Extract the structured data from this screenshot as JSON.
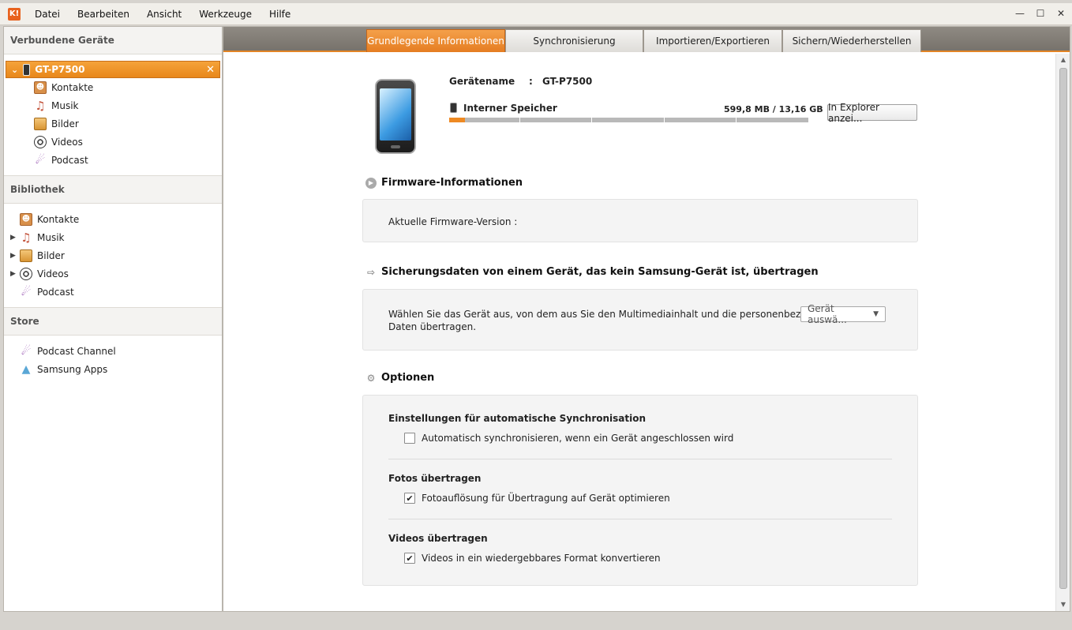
{
  "menu": {
    "logo": "K!",
    "items": [
      "Datei",
      "Bearbeiten",
      "Ansicht",
      "Werkzeuge",
      "Hilfe"
    ],
    "win_controls": [
      "—",
      "☐",
      "✕"
    ]
  },
  "sidebar": {
    "connected_header": "Verbundene Geräte",
    "device": {
      "name": "GT-P7500",
      "close": "✕",
      "expand": "⌄"
    },
    "device_items": [
      {
        "label": "Kontakte",
        "icon": "contacts-icon"
      },
      {
        "label": "Musik",
        "icon": "music-icon"
      },
      {
        "label": "Bilder",
        "icon": "pictures-icon"
      },
      {
        "label": "Videos",
        "icon": "videos-icon"
      },
      {
        "label": "Podcast",
        "icon": "podcast-icon"
      }
    ],
    "library_header": "Bibliothek",
    "library_items": [
      {
        "label": "Kontakte",
        "expandable": false
      },
      {
        "label": "Musik",
        "expandable": true
      },
      {
        "label": "Bilder",
        "expandable": true
      },
      {
        "label": "Videos",
        "expandable": true
      },
      {
        "label": "Podcast",
        "expandable": false
      }
    ],
    "store_header": "Store",
    "store_items": [
      {
        "label": "Podcast Channel",
        "icon": "podcast-channel-icon"
      },
      {
        "label": "Samsung Apps",
        "icon": "samsung-apps-icon"
      }
    ]
  },
  "tabs": [
    {
      "label": "Grundlegende Informationen",
      "active": true
    },
    {
      "label": "Synchronisierung",
      "active": false
    },
    {
      "label": "Importieren/Exportieren",
      "active": false
    },
    {
      "label": "Sichern/Wiederherstellen",
      "active": false
    }
  ],
  "device_info": {
    "name_label": "Gerätename",
    "separator": ":",
    "name_value": "GT-P7500",
    "storage_label": "Interner Speicher",
    "storage_value": "599,8 MB / 13,16 GB",
    "storage_used_fraction": 0.0445,
    "explorer_button": "In Explorer anzei..."
  },
  "firmware": {
    "title": "Firmware-Informationen",
    "current_label": "Aktuelle Firmware-Version :"
  },
  "transfer": {
    "title": "Sicherungsdaten von einem Gerät, das kein Samsung-Gerät ist, übertragen",
    "description_line1": "Wählen Sie das Gerät aus, von dem aus Sie den Multimediainhalt und die personenbezogenen",
    "description_line2": "Daten übertragen.",
    "dropdown_value": "Gerät auswä..."
  },
  "options": {
    "title": "Optionen",
    "auto_sync_head": "Einstellungen für automatische Synchronisation",
    "auto_sync_label": "Automatisch synchronisieren, wenn ein Gerät angeschlossen wird",
    "auto_sync_checked": false,
    "photos_head": "Fotos übertragen",
    "photos_label": "Fotoauflösung für Übertragung auf Gerät optimieren",
    "photos_checked": true,
    "videos_head": "Videos übertragen",
    "videos_label": "Videos in ein wiedergebbares Format konvertieren",
    "videos_checked": true
  }
}
